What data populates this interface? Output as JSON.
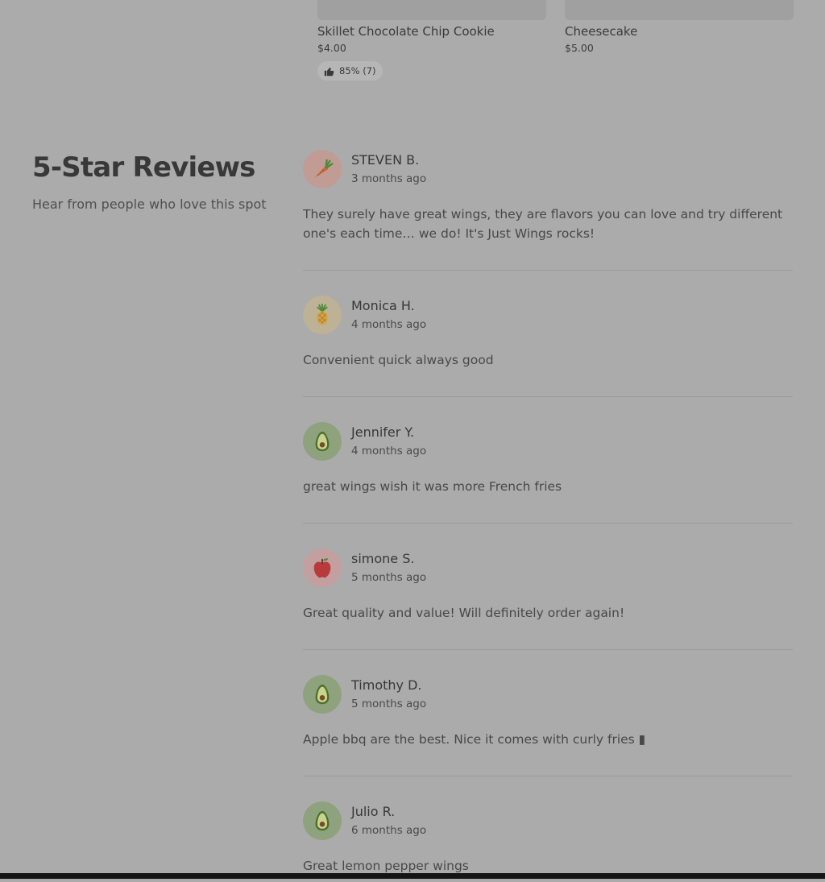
{
  "menu_items": [
    {
      "name": "Skillet Chocolate Chip Cookie",
      "price": "$4.00",
      "rating": "85% (7)"
    },
    {
      "name": "Cheesecake",
      "price": "$5.00",
      "rating": ""
    }
  ],
  "reviews_section": {
    "title": "5-Star Reviews",
    "subtitle": "Hear from people who love this spot",
    "reviews": [
      {
        "name": "STEVEN B.",
        "date": "3 months ago",
        "avatar_icon": "carrot-icon",
        "text": "They surely have great wings, they are flavors you can love and try different one's each time… we do! It's Just Wings rocks!"
      },
      {
        "name": "Monica H.",
        "date": "4 months ago",
        "avatar_icon": "pineapple-icon",
        "text": "Convenient quick always good"
      },
      {
        "name": "Jennifer Y.",
        "date": "4 months ago",
        "avatar_icon": "avocado-icon",
        "text": "great wings wish it was more French fries"
      },
      {
        "name": "simone S.",
        "date": "5 months ago",
        "avatar_icon": "apple-icon",
        "text": "Great quality and value! Will definitely order again!"
      },
      {
        "name": "Timothy D.",
        "date": "5 months ago",
        "avatar_icon": "avocado-icon",
        "text": "Apple bbq are the best. Nice it comes with curly fries ▮"
      },
      {
        "name": "Julio R.",
        "date": "6 months ago",
        "avatar_icon": "avocado-icon",
        "text": "Great lemon pepper wings"
      }
    ]
  }
}
